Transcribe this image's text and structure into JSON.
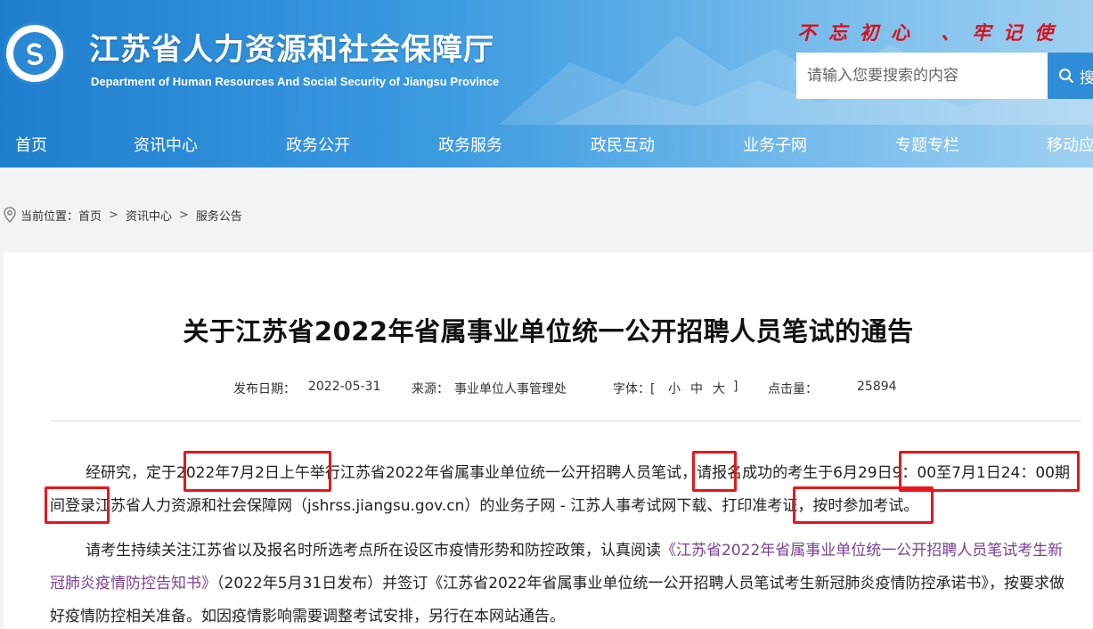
{
  "header": {
    "site_title": "江苏省人力资源和社会保障厅",
    "site_subtitle": "Department of Human Resources And Social Security of Jiangsu Province",
    "slogan": "不忘初心 、牢记使",
    "search_placeholder": "请输入您要搜索的内容",
    "search_button": "搜",
    "brand_color": "#2a88d5",
    "slogan_color": "#d4111c"
  },
  "nav": {
    "items": [
      "首页",
      "资讯中心",
      "政务公开",
      "政务服务",
      "政民互动",
      "业务子网",
      "专题专栏",
      "移动应"
    ]
  },
  "breadcrumb": {
    "prefix": "当前位置：",
    "items": [
      "首页",
      "资讯中心",
      "服务公告"
    ],
    "separator": ">"
  },
  "article": {
    "title": "关于江苏省2022年省属事业单位统一公开招聘人员笔试的通告",
    "meta": {
      "date_label": "发布日期：",
      "date": "2022-05-31",
      "source_label": "来源：",
      "source": "事业单位人事管理处",
      "font_label": "字体：[",
      "font_small": "小",
      "font_medium": "中",
      "font_large": "大",
      "font_close": "]",
      "views_label": "点击量：",
      "views": "25894"
    },
    "para1": {
      "t1": "经研究，定于",
      "t2": "2022年7月2日上午举行江苏省2022年省属事业单位统一公开招聘人员笔试，请报名成功的考生于",
      "t3": "6月29日9：00至7月1日24：00期间登录江苏省人力资源和社会保障网（jshrss.jiangsu.gov.cn）的业务子网 - 江苏人事考试网下载、打印准考证，按时参加考试。"
    },
    "para2": {
      "t1": "请考生持续关注江苏省以及报名时所选考点所在设区市疫情形势和防控政策，认真阅读",
      "link": "《江苏省2022年省属事业单位统一公开招聘人员笔试考生新冠肺炎疫情防控告知书》",
      "t2": "（2022年5月31日发布）并签订《江苏省2022年省属事业单位统一公开招聘人员笔试考生新冠肺炎疫情防控承诺书》，按要求做好疫情防控相关准备。如因疫情影响需要调整考试安排，另行在本网站通告。"
    },
    "link_color": "#7a3f96",
    "highlight_color": "#e8161c"
  }
}
